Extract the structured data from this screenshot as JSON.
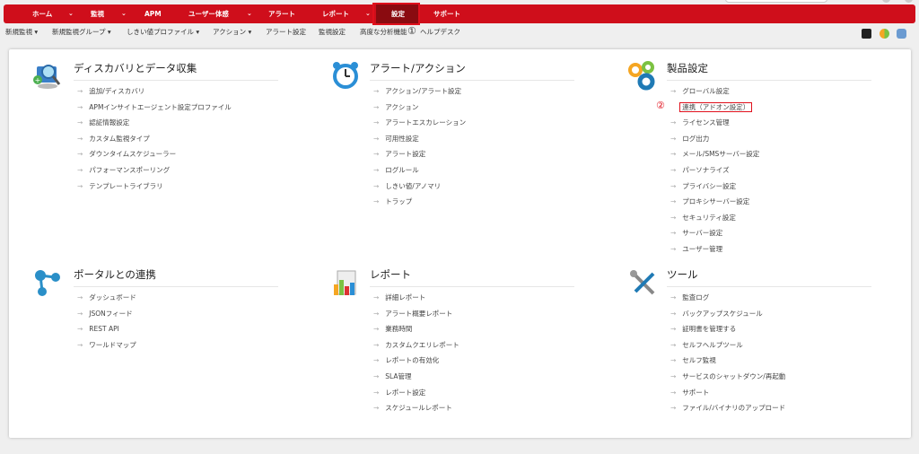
{
  "nav": {
    "items": [
      "ホーム",
      "監視",
      "APM",
      "ユーザー体感",
      "アラート",
      "レポート",
      "設定",
      "サポート"
    ],
    "active": "設定"
  },
  "subnav": {
    "items": [
      "新規監視 ▾",
      "新規監視グループ ▾",
      "しきい値プロファイル ▾",
      "アクション ▾",
      "アラート設定",
      "監視設定",
      "高度な分析機能",
      "ヘルプデスク"
    ]
  },
  "annotations": {
    "one": "①",
    "two": "②"
  },
  "sections": {
    "discovery": {
      "title": "ディスカバリとデータ収集",
      "items": [
        "追加/ディスカバリ",
        "APMインサイトエージェント設定プロファイル",
        "認証情報設定",
        "カスタム監視タイプ",
        "ダウンタイムスケジューラー",
        "パフォーマンスポーリング",
        "テンプレートライブラリ"
      ]
    },
    "alerts": {
      "title": "アラート/アクション",
      "items": [
        "アクション/アラート設定",
        "アクション",
        "アラートエスカレーション",
        "可用性設定",
        "アラート設定",
        "ログルール",
        "しきい値/アノマリ",
        "トラップ"
      ]
    },
    "product": {
      "title": "製品設定",
      "items": [
        "グローバル設定",
        "連携（アドオン設定）",
        "ライセンス管理",
        "ログ出力",
        "メール/SMSサーバー設定",
        "パーソナライズ",
        "プライバシー設定",
        "プロキシサーバー設定",
        "セキュリティ設定",
        "サーバー設定",
        "ユーザー管理"
      ]
    },
    "portal": {
      "title": "ポータルとの連携",
      "items": [
        "ダッシュボード",
        "JSONフィード",
        "REST API",
        "ワールドマップ"
      ]
    },
    "reports": {
      "title": "レポート",
      "items": [
        "詳細レポート",
        "アラート概要レポート",
        "業務時間",
        "カスタムクエリレポート",
        "レポートの有効化",
        "SLA管理",
        "レポート設定",
        "スケジュールレポート"
      ]
    },
    "tools": {
      "title": "ツール",
      "items": [
        "監査ログ",
        "バックアップスケジュール",
        "証明書を管理する",
        "セルフヘルプツール",
        "セルフ監視",
        "サービスのシャットダウン/再起動",
        "サポート",
        "ファイル/バイナリのアップロード"
      ]
    }
  }
}
